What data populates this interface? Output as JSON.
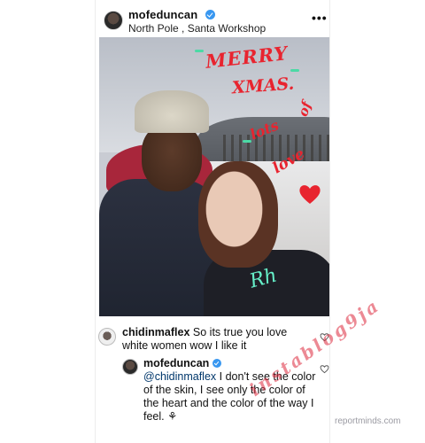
{
  "post": {
    "username": "mofeduncan",
    "location": "North Pole , Santa Workshop",
    "more_icon": "more-horizontal-icon",
    "more_label": "•••"
  },
  "image_text": {
    "merry": "MERRY",
    "xmas": "XMAS.",
    "lots": "lots",
    "of": "of",
    "love": "love",
    "signature": "Rh"
  },
  "comments": [
    {
      "username": "chidinmaflex",
      "text": "So its true you love white women wow I like it"
    },
    {
      "username": "mofeduncan",
      "mention": "@chidinmaflex",
      "text": "I don't see the color of the skin, I see only the color of the heart and the color of the way I feel. ⚘"
    }
  ],
  "watermark": "instablog9ja",
  "site_mark": "reportminds.com",
  "colors": {
    "verified": "#3897f0",
    "drawing_red": "#e8242f",
    "signature_green": "#66f0c9"
  }
}
